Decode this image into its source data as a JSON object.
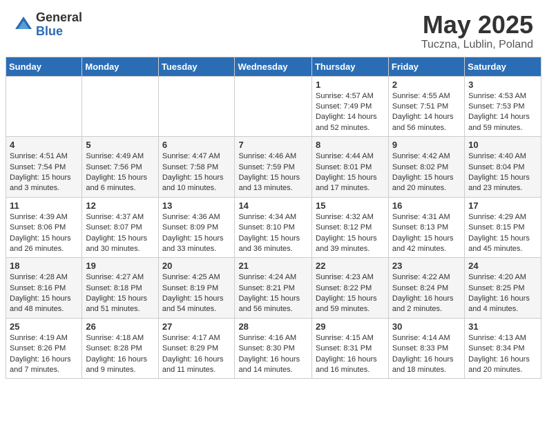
{
  "logo": {
    "general": "General",
    "blue": "Blue"
  },
  "header": {
    "month": "May 2025",
    "location": "Tuczna, Lublin, Poland"
  },
  "weekdays": [
    "Sunday",
    "Monday",
    "Tuesday",
    "Wednesday",
    "Thursday",
    "Friday",
    "Saturday"
  ],
  "weeks": [
    [
      {
        "day": "",
        "info": ""
      },
      {
        "day": "",
        "info": ""
      },
      {
        "day": "",
        "info": ""
      },
      {
        "day": "",
        "info": ""
      },
      {
        "day": "1",
        "info": "Sunrise: 4:57 AM\nSunset: 7:49 PM\nDaylight: 14 hours\nand 52 minutes."
      },
      {
        "day": "2",
        "info": "Sunrise: 4:55 AM\nSunset: 7:51 PM\nDaylight: 14 hours\nand 56 minutes."
      },
      {
        "day": "3",
        "info": "Sunrise: 4:53 AM\nSunset: 7:53 PM\nDaylight: 14 hours\nand 59 minutes."
      }
    ],
    [
      {
        "day": "4",
        "info": "Sunrise: 4:51 AM\nSunset: 7:54 PM\nDaylight: 15 hours\nand 3 minutes."
      },
      {
        "day": "5",
        "info": "Sunrise: 4:49 AM\nSunset: 7:56 PM\nDaylight: 15 hours\nand 6 minutes."
      },
      {
        "day": "6",
        "info": "Sunrise: 4:47 AM\nSunset: 7:58 PM\nDaylight: 15 hours\nand 10 minutes."
      },
      {
        "day": "7",
        "info": "Sunrise: 4:46 AM\nSunset: 7:59 PM\nDaylight: 15 hours\nand 13 minutes."
      },
      {
        "day": "8",
        "info": "Sunrise: 4:44 AM\nSunset: 8:01 PM\nDaylight: 15 hours\nand 17 minutes."
      },
      {
        "day": "9",
        "info": "Sunrise: 4:42 AM\nSunset: 8:02 PM\nDaylight: 15 hours\nand 20 minutes."
      },
      {
        "day": "10",
        "info": "Sunrise: 4:40 AM\nSunset: 8:04 PM\nDaylight: 15 hours\nand 23 minutes."
      }
    ],
    [
      {
        "day": "11",
        "info": "Sunrise: 4:39 AM\nSunset: 8:06 PM\nDaylight: 15 hours\nand 26 minutes."
      },
      {
        "day": "12",
        "info": "Sunrise: 4:37 AM\nSunset: 8:07 PM\nDaylight: 15 hours\nand 30 minutes."
      },
      {
        "day": "13",
        "info": "Sunrise: 4:36 AM\nSunset: 8:09 PM\nDaylight: 15 hours\nand 33 minutes."
      },
      {
        "day": "14",
        "info": "Sunrise: 4:34 AM\nSunset: 8:10 PM\nDaylight: 15 hours\nand 36 minutes."
      },
      {
        "day": "15",
        "info": "Sunrise: 4:32 AM\nSunset: 8:12 PM\nDaylight: 15 hours\nand 39 minutes."
      },
      {
        "day": "16",
        "info": "Sunrise: 4:31 AM\nSunset: 8:13 PM\nDaylight: 15 hours\nand 42 minutes."
      },
      {
        "day": "17",
        "info": "Sunrise: 4:29 AM\nSunset: 8:15 PM\nDaylight: 15 hours\nand 45 minutes."
      }
    ],
    [
      {
        "day": "18",
        "info": "Sunrise: 4:28 AM\nSunset: 8:16 PM\nDaylight: 15 hours\nand 48 minutes."
      },
      {
        "day": "19",
        "info": "Sunrise: 4:27 AM\nSunset: 8:18 PM\nDaylight: 15 hours\nand 51 minutes."
      },
      {
        "day": "20",
        "info": "Sunrise: 4:25 AM\nSunset: 8:19 PM\nDaylight: 15 hours\nand 54 minutes."
      },
      {
        "day": "21",
        "info": "Sunrise: 4:24 AM\nSunset: 8:21 PM\nDaylight: 15 hours\nand 56 minutes."
      },
      {
        "day": "22",
        "info": "Sunrise: 4:23 AM\nSunset: 8:22 PM\nDaylight: 15 hours\nand 59 minutes."
      },
      {
        "day": "23",
        "info": "Sunrise: 4:22 AM\nSunset: 8:24 PM\nDaylight: 16 hours\nand 2 minutes."
      },
      {
        "day": "24",
        "info": "Sunrise: 4:20 AM\nSunset: 8:25 PM\nDaylight: 16 hours\nand 4 minutes."
      }
    ],
    [
      {
        "day": "25",
        "info": "Sunrise: 4:19 AM\nSunset: 8:26 PM\nDaylight: 16 hours\nand 7 minutes."
      },
      {
        "day": "26",
        "info": "Sunrise: 4:18 AM\nSunset: 8:28 PM\nDaylight: 16 hours\nand 9 minutes."
      },
      {
        "day": "27",
        "info": "Sunrise: 4:17 AM\nSunset: 8:29 PM\nDaylight: 16 hours\nand 11 minutes."
      },
      {
        "day": "28",
        "info": "Sunrise: 4:16 AM\nSunset: 8:30 PM\nDaylight: 16 hours\nand 14 minutes."
      },
      {
        "day": "29",
        "info": "Sunrise: 4:15 AM\nSunset: 8:31 PM\nDaylight: 16 hours\nand 16 minutes."
      },
      {
        "day": "30",
        "info": "Sunrise: 4:14 AM\nSunset: 8:33 PM\nDaylight: 16 hours\nand 18 minutes."
      },
      {
        "day": "31",
        "info": "Sunrise: 4:13 AM\nSunset: 8:34 PM\nDaylight: 16 hours\nand 20 minutes."
      }
    ]
  ]
}
